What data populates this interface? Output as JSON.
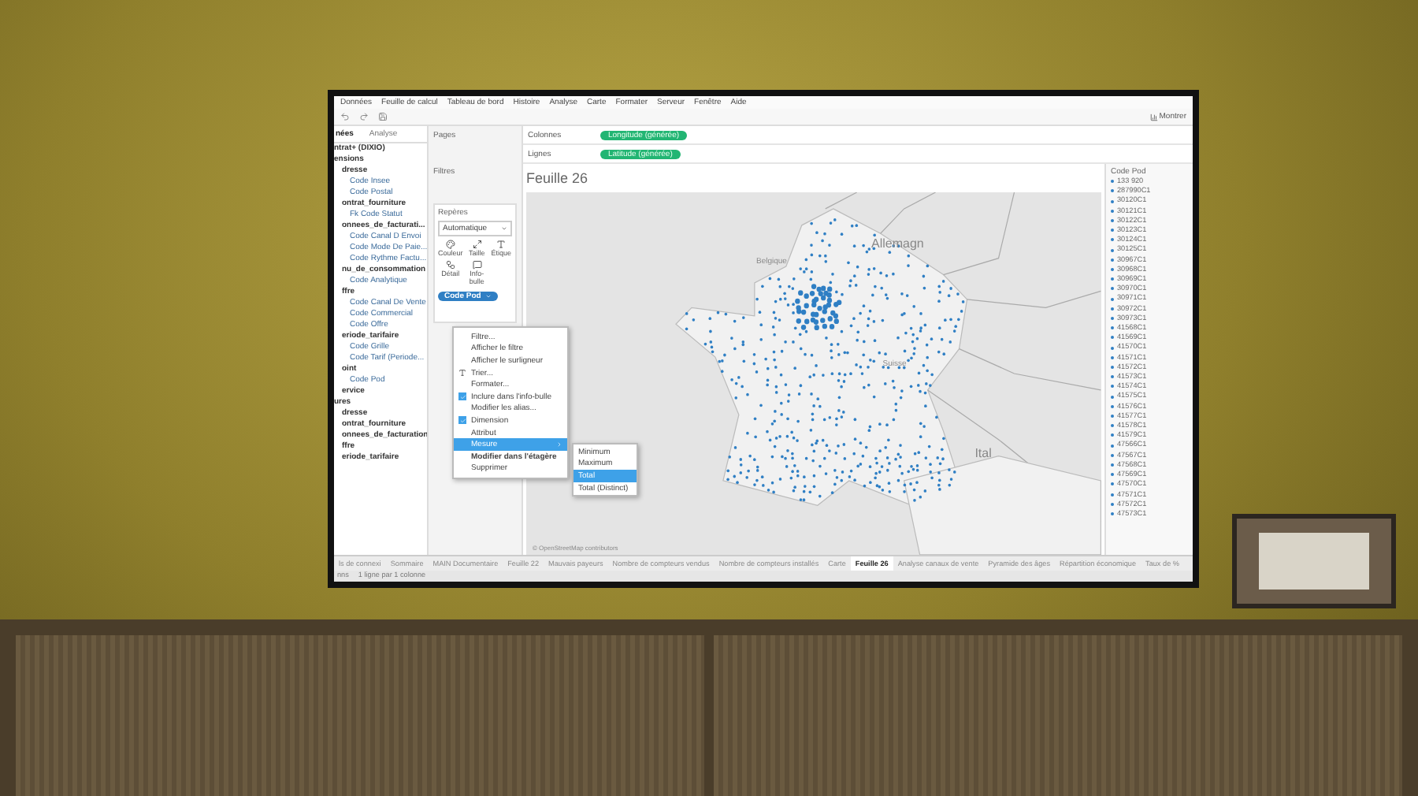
{
  "menu_bar": [
    "Données",
    "Feuille de calcul",
    "Tableau de bord",
    "Histoire",
    "Analyse",
    "Carte",
    "Formater",
    "Serveur",
    "Fenêtre",
    "Aide"
  ],
  "toolbar": {
    "show_me": "Montrer"
  },
  "data_pane": {
    "tabs": [
      {
        "label": "nées",
        "selected": true
      },
      {
        "label": "Analyse",
        "selected": false
      }
    ],
    "source": "ntrat+ (DIXIO)",
    "sections": [
      {
        "label": "ensions",
        "children": [
          {
            "label": "dresse",
            "children": [
              {
                "label": "Code Insee"
              },
              {
                "label": "Code Postal"
              }
            ]
          },
          {
            "label": "ontrat_fourniture",
            "children": [
              {
                "label": "Fk Code Statut"
              }
            ]
          },
          {
            "label": "onnees_de_facturati...",
            "children": [
              {
                "label": "Code Canal D Envoi"
              },
              {
                "label": "Code Mode De Paie..."
              },
              {
                "label": "Code Rythme Factu..."
              }
            ]
          },
          {
            "label": "nu_de_consommation",
            "children": [
              {
                "label": "Code Analytique"
              }
            ]
          },
          {
            "label": "ffre",
            "children": [
              {
                "label": "Code Canal De Vente"
              },
              {
                "label": "Code Commercial"
              },
              {
                "label": "Code Offre"
              }
            ]
          },
          {
            "label": "eriode_tarifaire",
            "children": [
              {
                "label": "Code Grille"
              },
              {
                "label": "Code Tarif (Periode..."
              }
            ]
          },
          {
            "label": "oint",
            "children": [
              {
                "label": "Code Pod"
              }
            ]
          },
          {
            "label": "ervice"
          }
        ]
      },
      {
        "label": "ures",
        "children": [
          {
            "label": "dresse"
          },
          {
            "label": "ontrat_fourniture"
          },
          {
            "label": "onnees_de_facturation"
          },
          {
            "label": "ffre"
          },
          {
            "label": "eriode_tarifaire"
          }
        ]
      }
    ]
  },
  "cards": {
    "pages": "Pages",
    "filters": "Filtres",
    "marks": "Repères",
    "mark_type": "Automatique",
    "buttons": [
      {
        "kind": "color",
        "label": "Couleur"
      },
      {
        "kind": "size",
        "label": "Taille"
      },
      {
        "kind": "label",
        "label": "Étique"
      },
      {
        "kind": "detail",
        "label": "Détail"
      },
      {
        "kind": "tooltip",
        "label": "Info-bulle"
      }
    ],
    "pill": "Code Pod"
  },
  "shelves": [
    {
      "label": "Colonnes",
      "pill": "Longitude (générée)"
    },
    {
      "label": "Lignes",
      "pill": "Latitude (générée)"
    }
  ],
  "sheet_title": "Feuille 26",
  "map": {
    "labels": [
      {
        "kind": "country",
        "text": "Allemagn"
      },
      {
        "kind": "country_small",
        "text": "Belgique"
      },
      {
        "kind": "country_small",
        "text": "Suisse"
      },
      {
        "kind": "country",
        "text": "Ital"
      }
    ],
    "credit": "© OpenStreetMap contributors"
  },
  "context_menu": [
    {
      "kind": "item",
      "label": "Filtre...",
      "selected": false
    },
    {
      "kind": "item",
      "label": "Afficher le filtre",
      "selected": false
    },
    {
      "kind": "item",
      "label": "Afficher le surligneur",
      "selected": false
    },
    {
      "kind": "sort",
      "label": "Trier...",
      "selected": false
    },
    {
      "kind": "item",
      "label": "Formater...",
      "selected": false
    },
    {
      "kind": "check",
      "label": "Inclure dans l'info-bulle",
      "checked": true,
      "selected": false
    },
    {
      "kind": "item",
      "label": "Modifier les alias...",
      "selected": false
    },
    {
      "kind": "check",
      "label": "Dimension",
      "checked": true,
      "selected": false
    },
    {
      "kind": "item",
      "label": "Attribut",
      "selected": false
    },
    {
      "kind": "submenu",
      "label": "Mesure",
      "selected": true
    },
    {
      "kind": "bold",
      "label": "Modifier dans l'étagère",
      "selected": false
    },
    {
      "kind": "item",
      "label": "Supprimer",
      "selected": false
    }
  ],
  "submenu": [
    {
      "label": "Minimum",
      "selected": false
    },
    {
      "label": "Maximum",
      "selected": false
    },
    {
      "label": "Total",
      "selected": true
    },
    {
      "label": "Total (Distinct)",
      "selected": false
    }
  ],
  "legend": {
    "title": "Code Pod",
    "items": [
      "133 920",
      "287990C1",
      "30120C1",
      "30121C1",
      "30122C1",
      "30123C1",
      "30124C1",
      "30125C1",
      "30967C1",
      "30968C1",
      "30969C1",
      "30970C1",
      "30971C1",
      "30972C1",
      "30973C1",
      "41568C1",
      "41569C1",
      "41570C1",
      "41571C1",
      "41572C1",
      "41573C1",
      "41574C1",
      "41575C1",
      "41576C1",
      "41577C1",
      "41578C1",
      "41579C1",
      "47566C1",
      "47567C1",
      "47568C1",
      "47569C1",
      "47570C1",
      "47571C1",
      "47572C1",
      "47573C1"
    ]
  },
  "sheet_tabs": [
    {
      "label": "ls de connexi",
      "selected": false
    },
    {
      "label": "Sommaire",
      "selected": false
    },
    {
      "label": "MAIN Documentaire",
      "selected": false
    },
    {
      "label": "Feuille 22",
      "selected": false
    },
    {
      "label": "Mauvais payeurs",
      "selected": false
    },
    {
      "label": "Nombre de compteurs vendus",
      "selected": false
    },
    {
      "label": "Nombre de compteurs installés",
      "selected": false
    },
    {
      "label": "Carte",
      "selected": false
    },
    {
      "label": "Feuille 26",
      "selected": true
    },
    {
      "label": "Analyse canaux de vente",
      "selected": false
    },
    {
      "label": "Pyramide des âges",
      "selected": false
    },
    {
      "label": "Répartition économique",
      "selected": false
    },
    {
      "label": "Taux de %",
      "selected": false
    }
  ],
  "status_bar": [
    "nns",
    "1 ligne par 1 colonne"
  ]
}
